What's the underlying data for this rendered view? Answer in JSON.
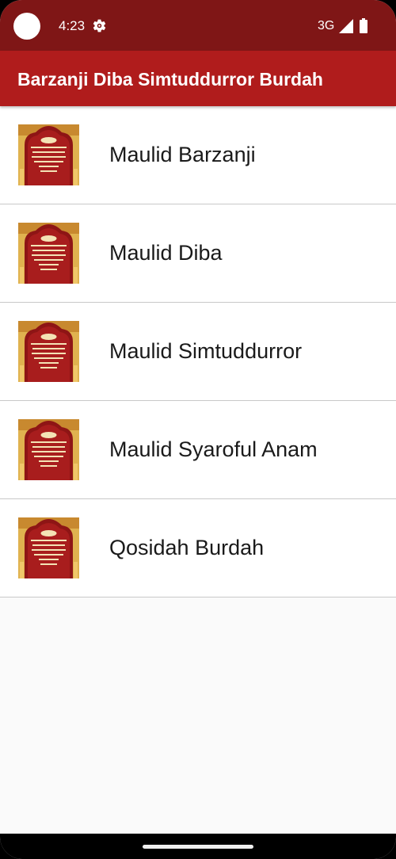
{
  "status_bar": {
    "time": "4:23",
    "network": "3G"
  },
  "app_bar": {
    "title": "Barzanji Diba Simtuddurror Burdah"
  },
  "items": [
    {
      "label": "Maulid Barzanji"
    },
    {
      "label": "Maulid Diba"
    },
    {
      "label": "Maulid Simtuddurror"
    },
    {
      "label": "Maulid Syaroful Anam"
    },
    {
      "label": "Qosidah Burdah"
    }
  ],
  "colors": {
    "status_bar": "#7f1616",
    "app_bar": "#b01c1c",
    "background": "#fafafa"
  },
  "icons": {
    "settings": "gear-icon",
    "signal": "signal-icon",
    "battery": "battery-icon"
  }
}
